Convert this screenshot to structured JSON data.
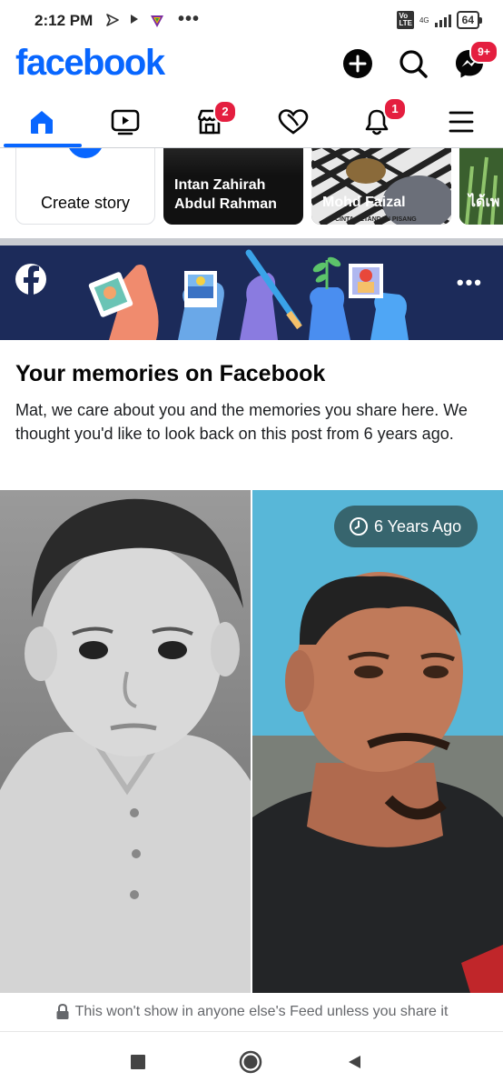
{
  "status": {
    "time": "2:12 PM",
    "network": "4G",
    "battery": "64"
  },
  "header": {
    "logo": "facebook",
    "messenger_badge": "9+"
  },
  "tabs": [
    {
      "name": "home",
      "badge": ""
    },
    {
      "name": "video",
      "badge": ""
    },
    {
      "name": "marketplace",
      "badge": "2"
    },
    {
      "name": "dating",
      "badge": ""
    },
    {
      "name": "notifications",
      "badge": "1"
    },
    {
      "name": "menu",
      "badge": ""
    }
  ],
  "stories": {
    "create_label": "Create story",
    "items": [
      {
        "name": "Intan Zahirah Abdul Rahman",
        "name_line1": "Intan Zahirah",
        "name_line2": "Abdul Rahman"
      },
      {
        "name": "Mohd Faizal",
        "caption": "CINTA SETANDAN PISANG"
      },
      {
        "name": "ได้เพ"
      }
    ]
  },
  "memories": {
    "title": "Your memories on Facebook",
    "description": "Mat, we care about you and the memories you share here. We thought you'd like to look back on this post from 6 years ago.",
    "years_ago": "6 Years Ago",
    "privacy_note": "This won't show in anyone else's Feed unless you share it"
  },
  "colors": {
    "brand": "#0866ff",
    "badge": "#e41e3f",
    "banner": "#1c2b5a"
  }
}
